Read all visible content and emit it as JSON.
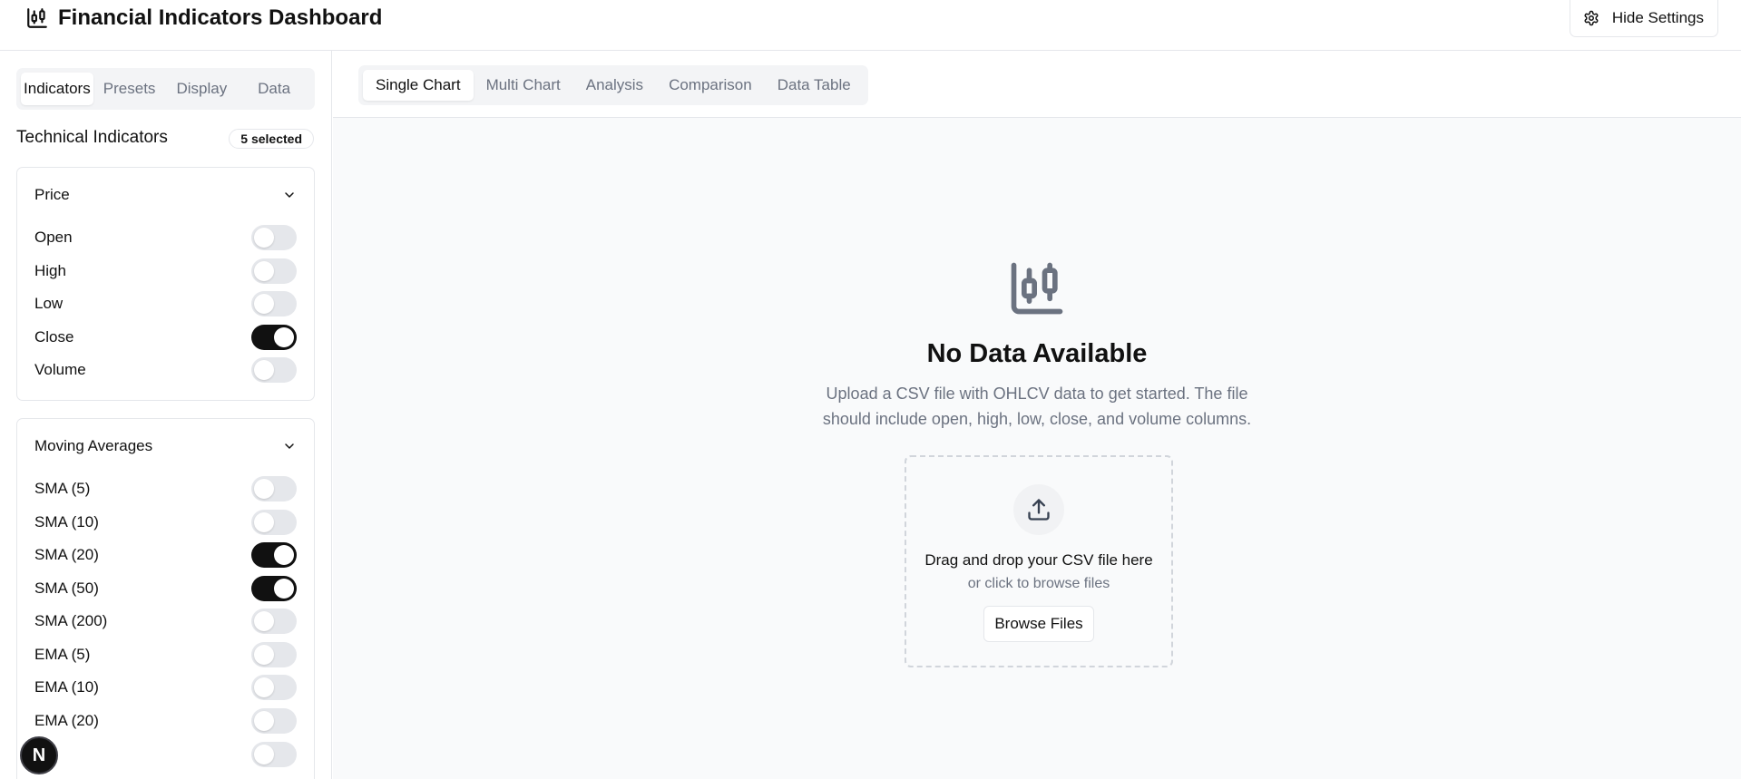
{
  "header": {
    "logo_icon": "candlestick-chart-icon",
    "title": "Financial Indicators Dashboard",
    "settings_icon": "gear-icon",
    "hide_settings_label": "Hide Settings"
  },
  "sidebar": {
    "tabs": [
      {
        "label": "Indicators",
        "active": true
      },
      {
        "label": "Presets",
        "active": false
      },
      {
        "label": "Display",
        "active": false
      },
      {
        "label": "Data",
        "active": false
      }
    ],
    "section_title": "Technical Indicators",
    "selected_badge": "5 selected",
    "groups": [
      {
        "title": "Price",
        "expanded": true,
        "items": [
          {
            "label": "Open",
            "enabled": false
          },
          {
            "label": "High",
            "enabled": false
          },
          {
            "label": "Low",
            "enabled": false
          },
          {
            "label": "Close",
            "enabled": true
          },
          {
            "label": "Volume",
            "enabled": false
          }
        ]
      },
      {
        "title": "Moving Averages",
        "expanded": true,
        "items": [
          {
            "label": "SMA (5)",
            "enabled": false
          },
          {
            "label": "SMA (10)",
            "enabled": false
          },
          {
            "label": "SMA (20)",
            "enabled": true
          },
          {
            "label": "SMA (50)",
            "enabled": true
          },
          {
            "label": "SMA (200)",
            "enabled": false
          },
          {
            "label": "EMA (5)",
            "enabled": false
          },
          {
            "label": "EMA (10)",
            "enabled": false
          },
          {
            "label": "EMA (20)",
            "enabled": false
          }
        ]
      }
    ],
    "dev_badge_label": "N"
  },
  "main": {
    "tabs": [
      {
        "label": "Single Chart",
        "active": true
      },
      {
        "label": "Multi Chart",
        "active": false
      },
      {
        "label": "Analysis",
        "active": false
      },
      {
        "label": "Comparison",
        "active": false
      },
      {
        "label": "Data Table",
        "active": false
      }
    ],
    "empty_state": {
      "icon": "candlestick-chart-icon",
      "title": "No Data Available",
      "description": "Upload a CSV file with OHLCV data to get started. The file should include open, high, low, close, and volume columns.",
      "upload_icon": "upload-icon",
      "drop_primary": "Drag and drop your CSV file here",
      "drop_secondary": "or click to browse files",
      "browse_label": "Browse Files"
    }
  },
  "colors": {
    "toggle_on": "#111111",
    "toggle_off": "#e5e7eb",
    "muted_text": "#6b7280",
    "border": "#e5e7eb",
    "main_bg": "#f9fafb"
  }
}
